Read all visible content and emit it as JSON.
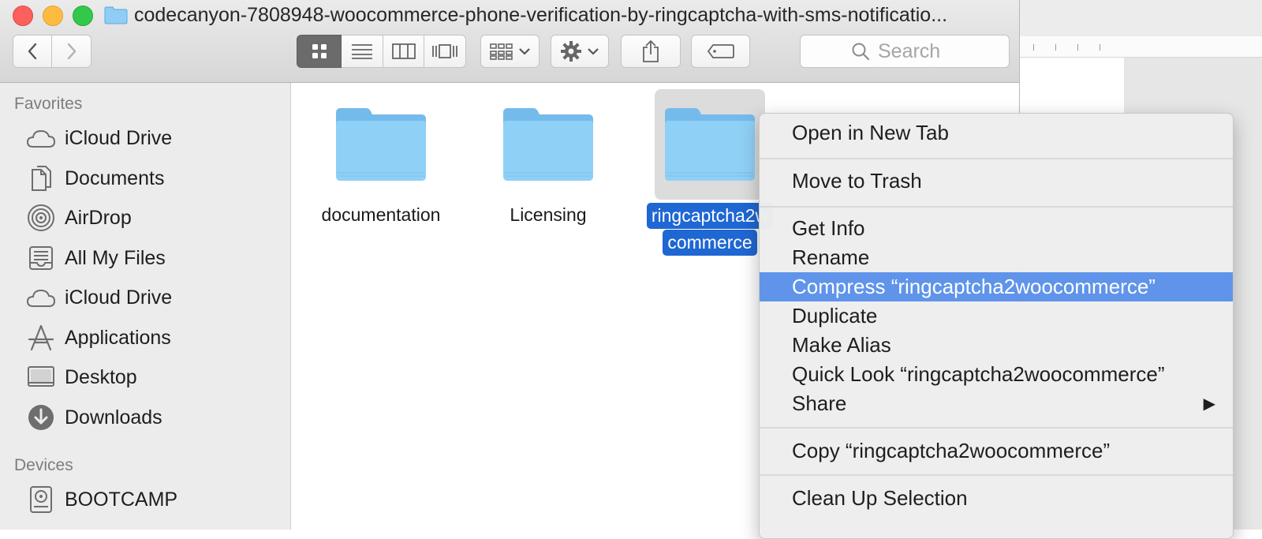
{
  "window": {
    "title": "codecanyon-7808948-woocommerce-phone-verification-by-ringcaptcha-with-sms-notificatio..."
  },
  "toolbar": {
    "view_modes": [
      "icon-view",
      "list-view",
      "column-view",
      "cover-flow-view"
    ],
    "active_view": "icon-view",
    "search_placeholder": "Search"
  },
  "sidebar": {
    "favorites_heading": "Favorites",
    "favorites": [
      {
        "label": "iCloud Drive",
        "icon": "cloud-icon"
      },
      {
        "label": "Documents",
        "icon": "documents-icon"
      },
      {
        "label": "AirDrop",
        "icon": "airdrop-icon"
      },
      {
        "label": "All My Files",
        "icon": "all-files-icon"
      },
      {
        "label": "iCloud Drive",
        "icon": "cloud-icon"
      },
      {
        "label": "Applications",
        "icon": "applications-icon"
      },
      {
        "label": "Desktop",
        "icon": "desktop-icon"
      },
      {
        "label": "Downloads",
        "icon": "downloads-icon"
      }
    ],
    "devices_heading": "Devices",
    "devices": [
      {
        "label": "BOOTCAMP",
        "icon": "disk-icon"
      }
    ]
  },
  "files": [
    {
      "name": "documentation",
      "selected": false
    },
    {
      "name": "Licensing",
      "selected": false
    },
    {
      "name_line1": "ringcaptcha2w",
      "name_line2": "commerce",
      "selected": true
    }
  ],
  "context_menu": {
    "items": [
      {
        "label": "Open in New Tab"
      },
      {
        "label": "Move to Trash"
      },
      {
        "label": "Get Info"
      },
      {
        "label": "Rename"
      },
      {
        "label": "Compress “ringcaptcha2woocommerce”",
        "highlighted": true
      },
      {
        "label": "Duplicate"
      },
      {
        "label": "Make Alias"
      },
      {
        "label": "Quick Look “ringcaptcha2woocommerce”"
      },
      {
        "label": "Share",
        "submenu": true
      },
      {
        "label": "Copy “ringcaptcha2woocommerce”"
      },
      {
        "label": "Clean Up Selection"
      }
    ]
  },
  "colors": {
    "selection": "#1f67d3",
    "menu_highlight": "#5f94ea",
    "folder": "#7cc6f4"
  }
}
